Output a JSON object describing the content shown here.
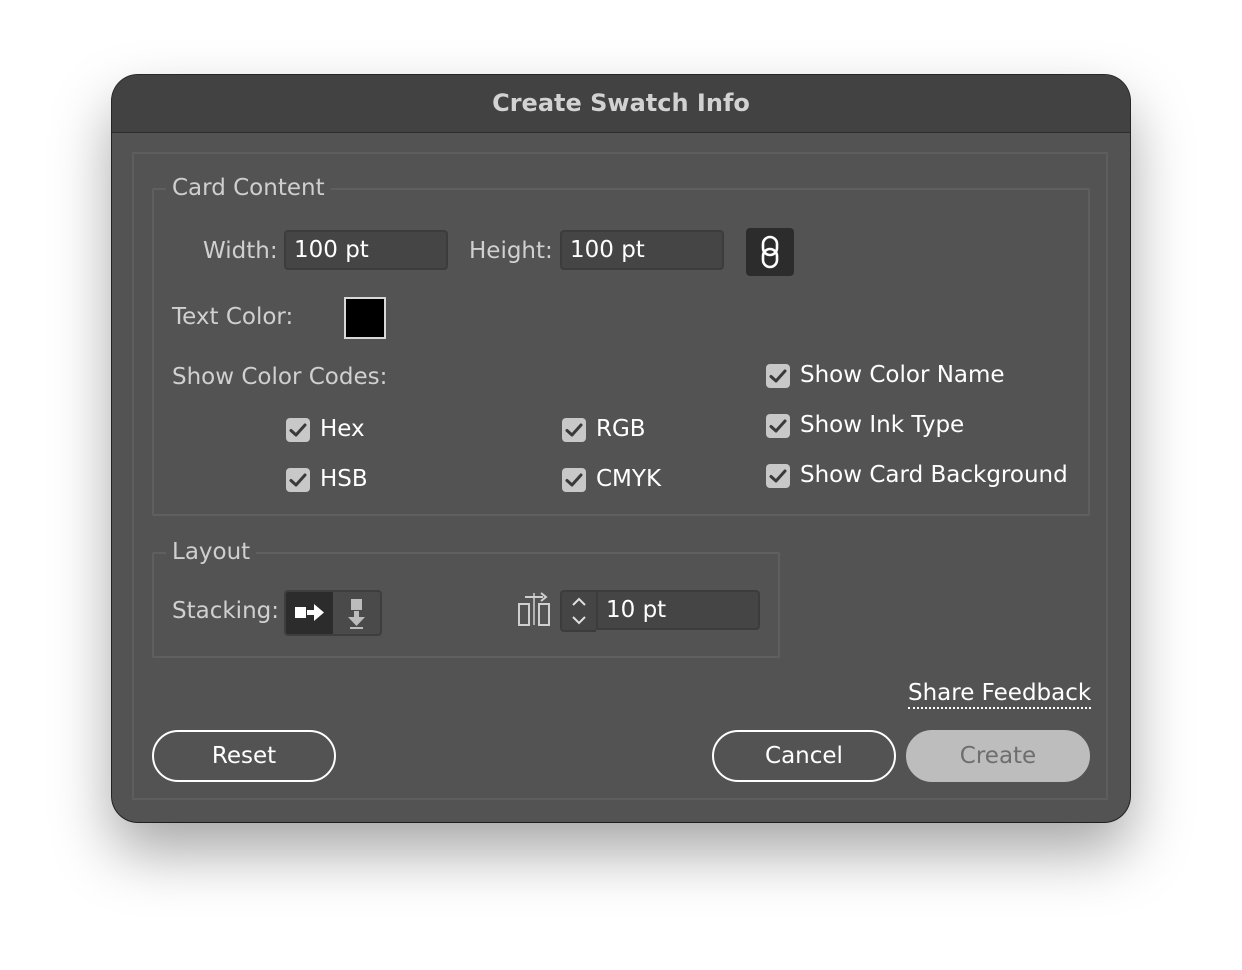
{
  "dialog": {
    "title": "Create Swatch Info"
  },
  "card_content": {
    "legend": "Card Content",
    "width_label": "Width:",
    "width_value": "100 pt",
    "height_label": "Height:",
    "height_value": "100 pt",
    "link_icon": "link-icon",
    "text_color_label": "Text Color:",
    "text_color_value": "#000000",
    "show_color_codes_label": "Show Color Codes:",
    "codes": [
      {
        "label": "Hex",
        "checked": true
      },
      {
        "label": "RGB",
        "checked": true
      },
      {
        "label": "HSB",
        "checked": true
      },
      {
        "label": "CMYK",
        "checked": true
      }
    ],
    "options": [
      {
        "label": "Show Color Name",
        "checked": true
      },
      {
        "label": "Show Ink Type",
        "checked": true
      },
      {
        "label": "Show Card Background",
        "checked": true
      }
    ]
  },
  "layout": {
    "legend": "Layout",
    "stacking_label": "Stacking:",
    "stacking_options": [
      "stack-horizontal-icon",
      "stack-vertical-icon"
    ],
    "stacking_selected": "horizontal",
    "spacing_icon": "spacing-icon",
    "spacing_value": "10 pt"
  },
  "footer": {
    "feedback_link": "Share Feedback",
    "reset_label": "Reset",
    "cancel_label": "Cancel",
    "create_label": "Create",
    "create_enabled": false
  },
  "colors": {
    "dialog_bg": "#535353",
    "titlebar_bg": "#424242",
    "field_bg": "#454545",
    "checkbox_bg": "#c8c8c8",
    "disabled_button_bg": "#bdbdbd"
  }
}
